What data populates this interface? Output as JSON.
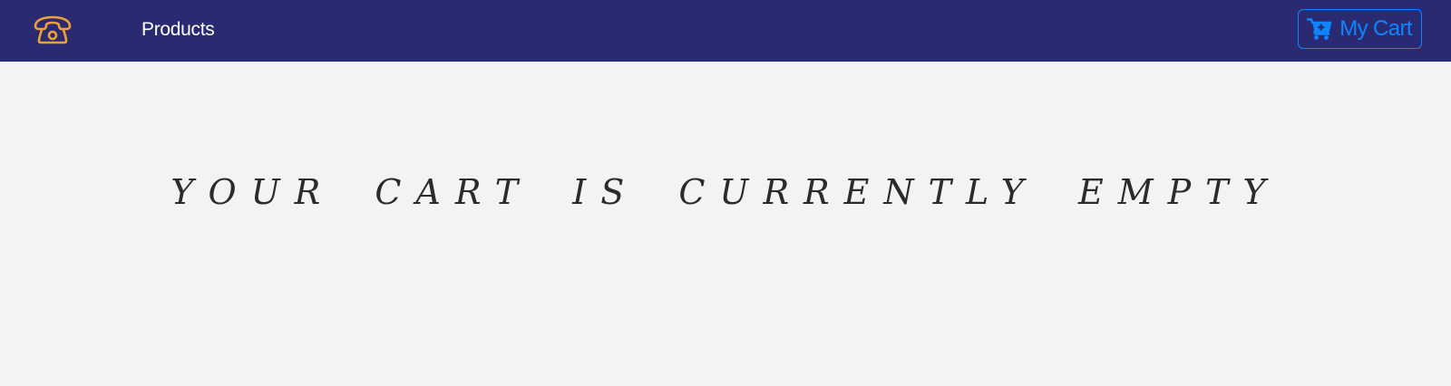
{
  "navbar": {
    "logo_icon": "telephone-icon",
    "products_link": "Products",
    "cart_button": {
      "icon": "cart-plus-icon",
      "label": "My Cart"
    }
  },
  "main": {
    "empty_message": "YOUR CART IS CURRENTLY EMPTY"
  },
  "colors": {
    "navbar_bg": "#2a2a72",
    "logo": "#f0a037",
    "accent": "#0f84ff",
    "page_bg": "#f3f3f3",
    "text": "#2b2b2b"
  }
}
